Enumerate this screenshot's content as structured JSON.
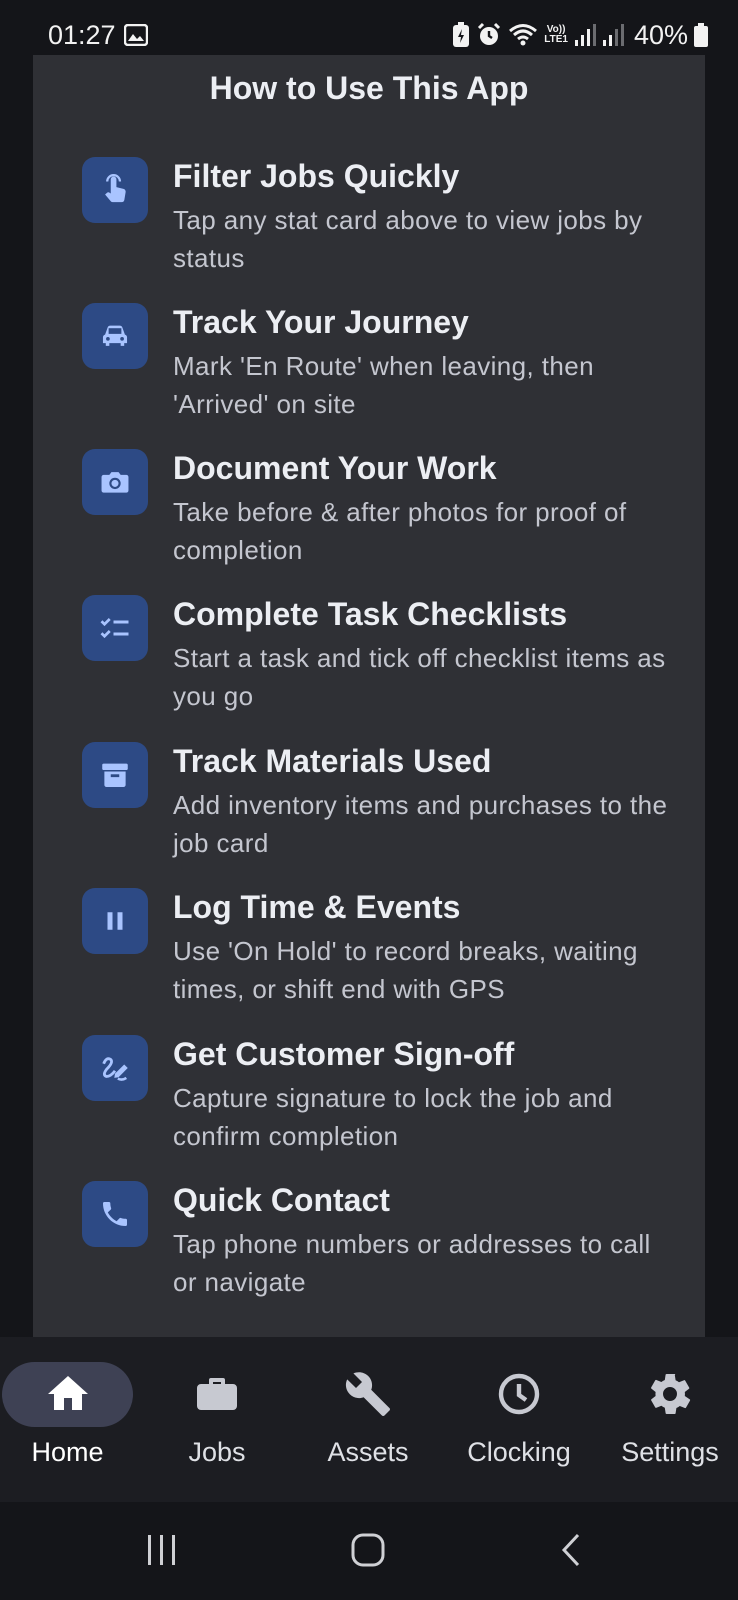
{
  "status_bar": {
    "time": "01:27",
    "volte_top": "Vo))",
    "volte_bottom": "LTE1",
    "battery": "40%"
  },
  "help": {
    "title": "How to Use This App",
    "tips": [
      {
        "icon": "tap-icon",
        "title": "Filter Jobs Quickly",
        "desc": "Tap any stat card above to view jobs by status"
      },
      {
        "icon": "car-icon",
        "title": "Track Your Journey",
        "desc": "Mark 'En Route' when leaving, then 'Arrived' on site"
      },
      {
        "icon": "camera-icon",
        "title": "Document Your Work",
        "desc": "Take before & after photos for proof of completion"
      },
      {
        "icon": "checklist-icon",
        "title": "Complete Task Checklists",
        "desc": "Start a task and tick off checklist items as you go"
      },
      {
        "icon": "archive-icon",
        "title": "Track Materials Used",
        "desc": "Add inventory items and purchases to the job card"
      },
      {
        "icon": "pause-icon",
        "title": "Log Time & Events",
        "desc": "Use 'On Hold' to record breaks, waiting times, or shift end with GPS"
      },
      {
        "icon": "signature-icon",
        "title": "Get Customer Sign-off",
        "desc": "Capture signature to lock the job and confirm completion"
      },
      {
        "icon": "phone-icon",
        "title": "Quick Contact",
        "desc": "Tap phone numbers or addresses to call or navigate"
      }
    ]
  },
  "nav": {
    "active": "Home",
    "items": [
      {
        "label": "Home",
        "icon": "home-icon"
      },
      {
        "label": "Jobs",
        "icon": "briefcase-icon"
      },
      {
        "label": "Assets",
        "icon": "wrench-icon"
      },
      {
        "label": "Clocking",
        "icon": "clock-icon"
      },
      {
        "label": "Settings",
        "icon": "gear-icon"
      }
    ]
  },
  "colors": {
    "card_bg": "#2f3035",
    "icon_tile": "#2d4a85",
    "icon_glyph": "#a9c4ff",
    "nav_pill": "#3e4154"
  }
}
